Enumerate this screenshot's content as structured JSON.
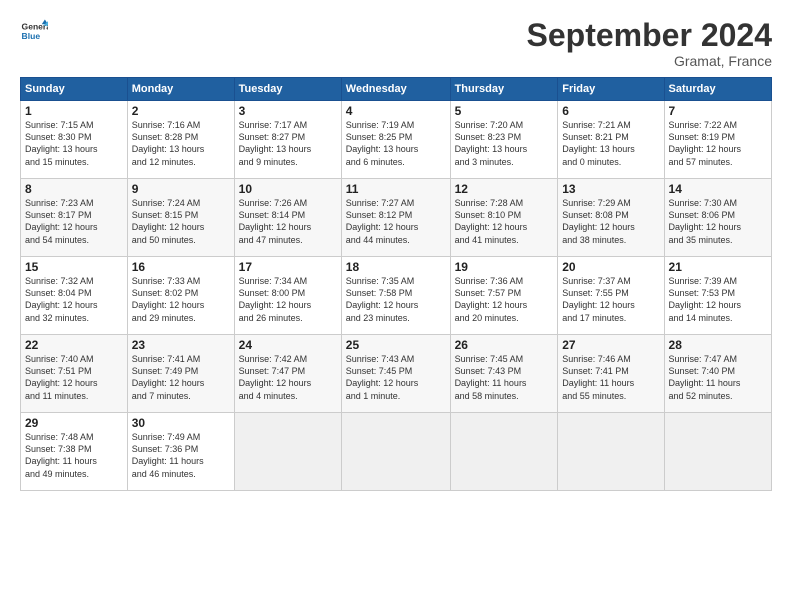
{
  "logo": {
    "line1": "General",
    "line2": "Blue"
  },
  "title": "September 2024",
  "location": "Gramat, France",
  "days_of_week": [
    "Sunday",
    "Monday",
    "Tuesday",
    "Wednesday",
    "Thursday",
    "Friday",
    "Saturday"
  ],
  "weeks": [
    [
      {
        "day": "1",
        "info": "Sunrise: 7:15 AM\nSunset: 8:30 PM\nDaylight: 13 hours\nand 15 minutes."
      },
      {
        "day": "2",
        "info": "Sunrise: 7:16 AM\nSunset: 8:28 PM\nDaylight: 13 hours\nand 12 minutes."
      },
      {
        "day": "3",
        "info": "Sunrise: 7:17 AM\nSunset: 8:27 PM\nDaylight: 13 hours\nand 9 minutes."
      },
      {
        "day": "4",
        "info": "Sunrise: 7:19 AM\nSunset: 8:25 PM\nDaylight: 13 hours\nand 6 minutes."
      },
      {
        "day": "5",
        "info": "Sunrise: 7:20 AM\nSunset: 8:23 PM\nDaylight: 13 hours\nand 3 minutes."
      },
      {
        "day": "6",
        "info": "Sunrise: 7:21 AM\nSunset: 8:21 PM\nDaylight: 13 hours\nand 0 minutes."
      },
      {
        "day": "7",
        "info": "Sunrise: 7:22 AM\nSunset: 8:19 PM\nDaylight: 12 hours\nand 57 minutes."
      }
    ],
    [
      {
        "day": "8",
        "info": "Sunrise: 7:23 AM\nSunset: 8:17 PM\nDaylight: 12 hours\nand 54 minutes."
      },
      {
        "day": "9",
        "info": "Sunrise: 7:24 AM\nSunset: 8:15 PM\nDaylight: 12 hours\nand 50 minutes."
      },
      {
        "day": "10",
        "info": "Sunrise: 7:26 AM\nSunset: 8:14 PM\nDaylight: 12 hours\nand 47 minutes."
      },
      {
        "day": "11",
        "info": "Sunrise: 7:27 AM\nSunset: 8:12 PM\nDaylight: 12 hours\nand 44 minutes."
      },
      {
        "day": "12",
        "info": "Sunrise: 7:28 AM\nSunset: 8:10 PM\nDaylight: 12 hours\nand 41 minutes."
      },
      {
        "day": "13",
        "info": "Sunrise: 7:29 AM\nSunset: 8:08 PM\nDaylight: 12 hours\nand 38 minutes."
      },
      {
        "day": "14",
        "info": "Sunrise: 7:30 AM\nSunset: 8:06 PM\nDaylight: 12 hours\nand 35 minutes."
      }
    ],
    [
      {
        "day": "15",
        "info": "Sunrise: 7:32 AM\nSunset: 8:04 PM\nDaylight: 12 hours\nand 32 minutes."
      },
      {
        "day": "16",
        "info": "Sunrise: 7:33 AM\nSunset: 8:02 PM\nDaylight: 12 hours\nand 29 minutes."
      },
      {
        "day": "17",
        "info": "Sunrise: 7:34 AM\nSunset: 8:00 PM\nDaylight: 12 hours\nand 26 minutes."
      },
      {
        "day": "18",
        "info": "Sunrise: 7:35 AM\nSunset: 7:58 PM\nDaylight: 12 hours\nand 23 minutes."
      },
      {
        "day": "19",
        "info": "Sunrise: 7:36 AM\nSunset: 7:57 PM\nDaylight: 12 hours\nand 20 minutes."
      },
      {
        "day": "20",
        "info": "Sunrise: 7:37 AM\nSunset: 7:55 PM\nDaylight: 12 hours\nand 17 minutes."
      },
      {
        "day": "21",
        "info": "Sunrise: 7:39 AM\nSunset: 7:53 PM\nDaylight: 12 hours\nand 14 minutes."
      }
    ],
    [
      {
        "day": "22",
        "info": "Sunrise: 7:40 AM\nSunset: 7:51 PM\nDaylight: 12 hours\nand 11 minutes."
      },
      {
        "day": "23",
        "info": "Sunrise: 7:41 AM\nSunset: 7:49 PM\nDaylight: 12 hours\nand 7 minutes."
      },
      {
        "day": "24",
        "info": "Sunrise: 7:42 AM\nSunset: 7:47 PM\nDaylight: 12 hours\nand 4 minutes."
      },
      {
        "day": "25",
        "info": "Sunrise: 7:43 AM\nSunset: 7:45 PM\nDaylight: 12 hours\nand 1 minute."
      },
      {
        "day": "26",
        "info": "Sunrise: 7:45 AM\nSunset: 7:43 PM\nDaylight: 11 hours\nand 58 minutes."
      },
      {
        "day": "27",
        "info": "Sunrise: 7:46 AM\nSunset: 7:41 PM\nDaylight: 11 hours\nand 55 minutes."
      },
      {
        "day": "28",
        "info": "Sunrise: 7:47 AM\nSunset: 7:40 PM\nDaylight: 11 hours\nand 52 minutes."
      }
    ],
    [
      {
        "day": "29",
        "info": "Sunrise: 7:48 AM\nSunset: 7:38 PM\nDaylight: 11 hours\nand 49 minutes."
      },
      {
        "day": "30",
        "info": "Sunrise: 7:49 AM\nSunset: 7:36 PM\nDaylight: 11 hours\nand 46 minutes."
      },
      {
        "day": "",
        "info": ""
      },
      {
        "day": "",
        "info": ""
      },
      {
        "day": "",
        "info": ""
      },
      {
        "day": "",
        "info": ""
      },
      {
        "day": "",
        "info": ""
      }
    ]
  ]
}
